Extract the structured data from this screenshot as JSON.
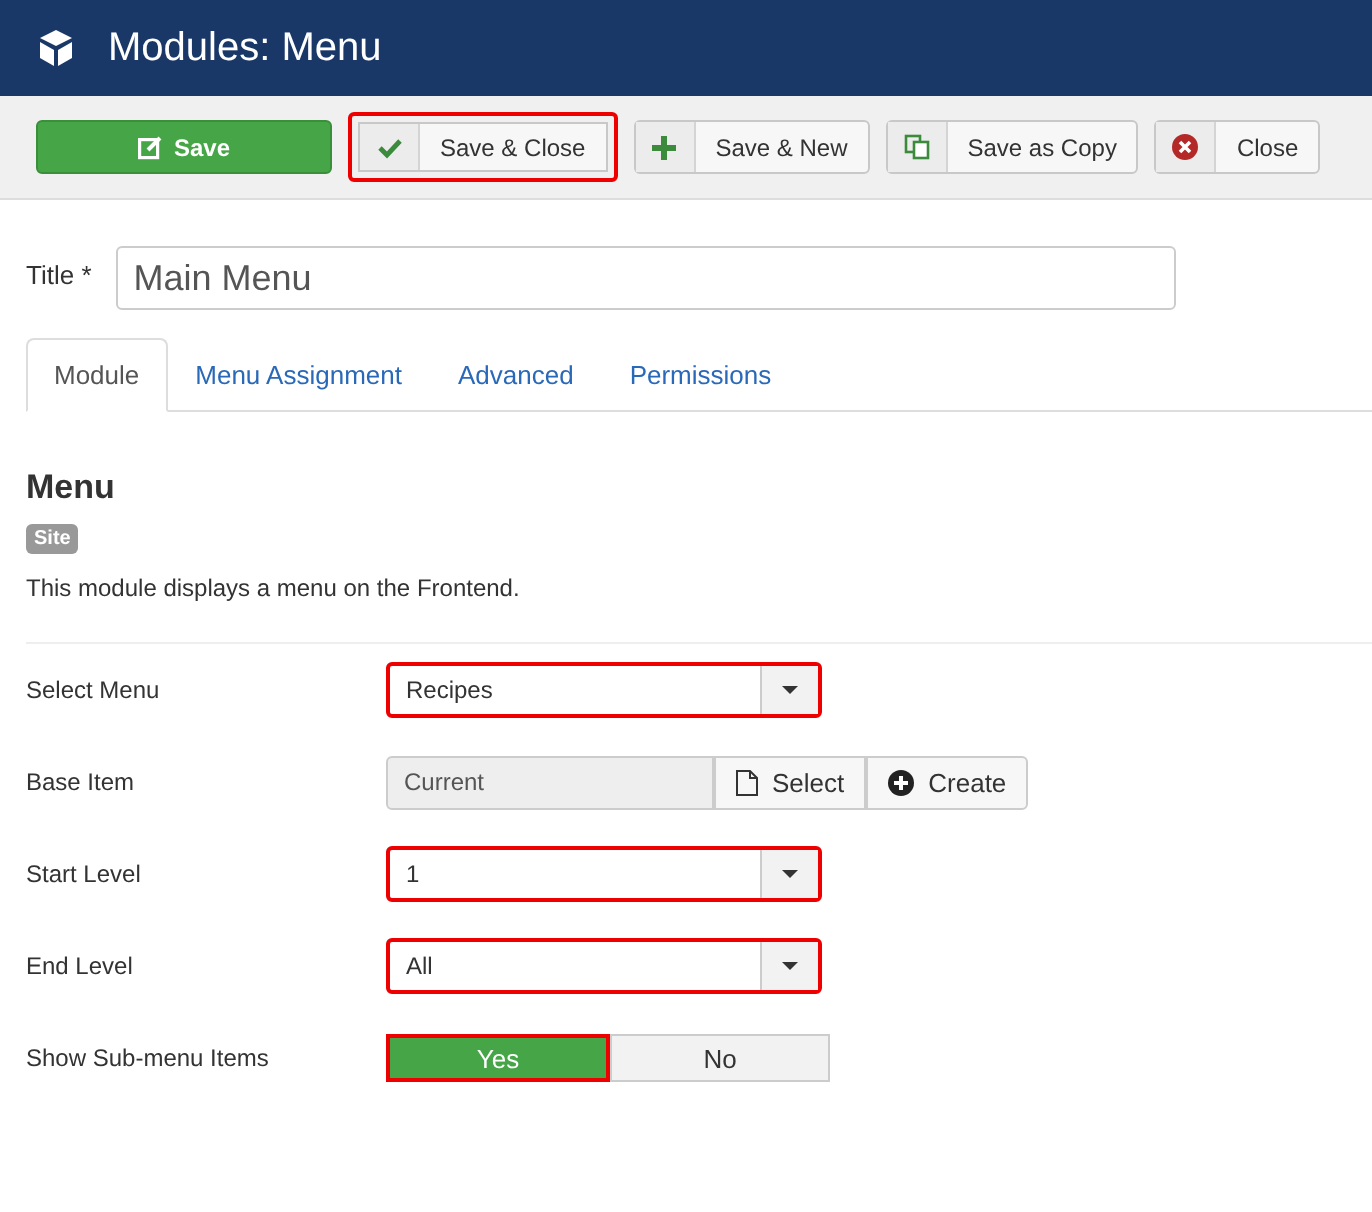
{
  "header": {
    "title": "Modules: Menu"
  },
  "toolbar": [
    {
      "label": "Save",
      "kind": "primary",
      "highlighted": false
    },
    {
      "label": "Save & Close",
      "kind": "default",
      "highlighted": true
    },
    {
      "label": "Save & New",
      "kind": "default",
      "highlighted": false
    },
    {
      "label": "Save as Copy",
      "kind": "default",
      "highlighted": false
    },
    {
      "label": "Close",
      "kind": "default",
      "highlighted": false
    }
  ],
  "title_field": {
    "label": "Title *",
    "value": "Main Menu"
  },
  "tabs": [
    {
      "label": "Module",
      "selected": true
    },
    {
      "label": "Menu Assignment",
      "selected": false
    },
    {
      "label": "Advanced",
      "selected": false
    },
    {
      "label": "Permissions",
      "selected": false
    }
  ],
  "module": {
    "heading": "Menu",
    "badge": "Site",
    "description": "This module displays a menu on the Frontend."
  },
  "fields": [
    {
      "label": "Select Menu",
      "kind": "select",
      "value": "Recipes",
      "highlighted": true
    },
    {
      "label": "Base Item",
      "kind": "modal",
      "value": "Current",
      "buttons": [
        "Select",
        "Create"
      ],
      "highlighted": false
    },
    {
      "label": "Start Level",
      "kind": "select",
      "value": "1",
      "highlighted": true
    },
    {
      "label": "End Level",
      "kind": "select",
      "value": "All",
      "highlighted": true
    },
    {
      "label": "Show Sub-menu Items",
      "kind": "toggle",
      "options": [
        {
          "label": "Yes",
          "selected": true
        },
        {
          "label": "No",
          "selected": false
        }
      ],
      "highlighted": true
    }
  ]
}
